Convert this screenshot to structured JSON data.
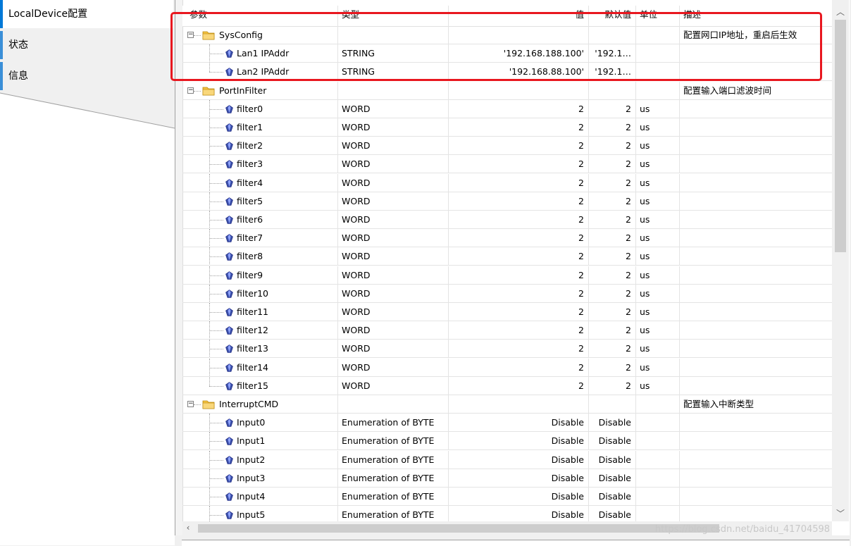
{
  "left_tabs": [
    {
      "label": "LocalDevice配置",
      "active": true
    },
    {
      "label": "状态",
      "active": false
    },
    {
      "label": "信息",
      "active": false
    }
  ],
  "columns": [
    "参数",
    "类型",
    "值",
    "默认值",
    "单位",
    "描述"
  ],
  "rows": [
    {
      "kind": "group",
      "name": "SysConfig",
      "type": "",
      "value": "",
      "default": "",
      "unit": "",
      "desc": "配置网口IP地址，重启后生效"
    },
    {
      "kind": "item",
      "name": "Lan1 IPAddr",
      "type": "STRING",
      "value": "'192.168.188.100'",
      "default": "'192.1…",
      "unit": "",
      "desc": ""
    },
    {
      "kind": "item",
      "name": "Lan2 IPAddr",
      "type": "STRING",
      "value": "'192.168.88.100'",
      "default": "'192.1…",
      "unit": "",
      "desc": "",
      "last": true
    },
    {
      "kind": "group",
      "name": "PortInFilter",
      "type": "",
      "value": "",
      "default": "",
      "unit": "",
      "desc": "配置输入端口滤波时间"
    },
    {
      "kind": "item",
      "name": "filter0",
      "type": "WORD",
      "value": "2",
      "default": "2",
      "unit": "us",
      "desc": ""
    },
    {
      "kind": "item",
      "name": "filter1",
      "type": "WORD",
      "value": "2",
      "default": "2",
      "unit": "us",
      "desc": ""
    },
    {
      "kind": "item",
      "name": "filter2",
      "type": "WORD",
      "value": "2",
      "default": "2",
      "unit": "us",
      "desc": ""
    },
    {
      "kind": "item",
      "name": "filter3",
      "type": "WORD",
      "value": "2",
      "default": "2",
      "unit": "us",
      "desc": ""
    },
    {
      "kind": "item",
      "name": "filter4",
      "type": "WORD",
      "value": "2",
      "default": "2",
      "unit": "us",
      "desc": ""
    },
    {
      "kind": "item",
      "name": "filter5",
      "type": "WORD",
      "value": "2",
      "default": "2",
      "unit": "us",
      "desc": ""
    },
    {
      "kind": "item",
      "name": "filter6",
      "type": "WORD",
      "value": "2",
      "default": "2",
      "unit": "us",
      "desc": ""
    },
    {
      "kind": "item",
      "name": "filter7",
      "type": "WORD",
      "value": "2",
      "default": "2",
      "unit": "us",
      "desc": ""
    },
    {
      "kind": "item",
      "name": "filter8",
      "type": "WORD",
      "value": "2",
      "default": "2",
      "unit": "us",
      "desc": ""
    },
    {
      "kind": "item",
      "name": "filter9",
      "type": "WORD",
      "value": "2",
      "default": "2",
      "unit": "us",
      "desc": ""
    },
    {
      "kind": "item",
      "name": "filter10",
      "type": "WORD",
      "value": "2",
      "default": "2",
      "unit": "us",
      "desc": ""
    },
    {
      "kind": "item",
      "name": "filter11",
      "type": "WORD",
      "value": "2",
      "default": "2",
      "unit": "us",
      "desc": ""
    },
    {
      "kind": "item",
      "name": "filter12",
      "type": "WORD",
      "value": "2",
      "default": "2",
      "unit": "us",
      "desc": ""
    },
    {
      "kind": "item",
      "name": "filter13",
      "type": "WORD",
      "value": "2",
      "default": "2",
      "unit": "us",
      "desc": ""
    },
    {
      "kind": "item",
      "name": "filter14",
      "type": "WORD",
      "value": "2",
      "default": "2",
      "unit": "us",
      "desc": ""
    },
    {
      "kind": "item",
      "name": "filter15",
      "type": "WORD",
      "value": "2",
      "default": "2",
      "unit": "us",
      "desc": "",
      "last": true
    },
    {
      "kind": "group",
      "name": "InterruptCMD",
      "type": "",
      "value": "",
      "default": "",
      "unit": "",
      "desc": "配置输入中断类型"
    },
    {
      "kind": "item",
      "name": "Input0",
      "type": "Enumeration of BYTE",
      "value": "Disable",
      "default": "Disable",
      "unit": "",
      "desc": ""
    },
    {
      "kind": "item",
      "name": "Input1",
      "type": "Enumeration of BYTE",
      "value": "Disable",
      "default": "Disable",
      "unit": "",
      "desc": ""
    },
    {
      "kind": "item",
      "name": "Input2",
      "type": "Enumeration of BYTE",
      "value": "Disable",
      "default": "Disable",
      "unit": "",
      "desc": ""
    },
    {
      "kind": "item",
      "name": "Input3",
      "type": "Enumeration of BYTE",
      "value": "Disable",
      "default": "Disable",
      "unit": "",
      "desc": ""
    },
    {
      "kind": "item",
      "name": "Input4",
      "type": "Enumeration of BYTE",
      "value": "Disable",
      "default": "Disable",
      "unit": "",
      "desc": ""
    },
    {
      "kind": "item",
      "name": "Input5",
      "type": "Enumeration of BYTE",
      "value": "Disable",
      "default": "Disable",
      "unit": "",
      "desc": ""
    }
  ],
  "watermark": "https://blog.csdn.net/baidu_41704598",
  "colors": {
    "accent": "#0078d7",
    "annotation": "#e8171f",
    "folder": "#f5c342"
  }
}
